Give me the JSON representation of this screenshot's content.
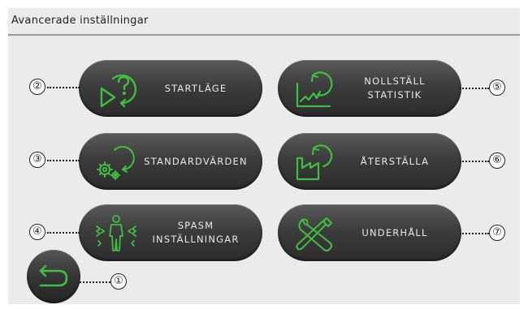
{
  "header": {
    "title": "Avancerade inställningar"
  },
  "buttons": {
    "startlage": {
      "label": "STARTLÄGE",
      "icon": "start-mode-icon"
    },
    "nollstall": {
      "line1": "NOLLSTÄLL",
      "line2": "STATISTIK",
      "icon": "reset-statistics-icon"
    },
    "standardvarden": {
      "label": "STANDARDVÄRDEN",
      "icon": "default-values-icon"
    },
    "aterstalla": {
      "label": "ÅTERSTÄLLA",
      "icon": "factory-reset-icon"
    },
    "spasm": {
      "line1": "SPASM",
      "line2": "INSTÄLLNINGAR",
      "icon": "spasm-body-icon"
    },
    "underhall": {
      "label": "UNDERHÅLL",
      "icon": "tools-icon"
    },
    "back": {
      "icon": "back-arrow-icon"
    }
  },
  "callouts": [
    "①",
    "②",
    "③",
    "④",
    "⑤",
    "⑥",
    "⑦"
  ],
  "colors": {
    "accent": "#3fbf3f",
    "button_dark": "#333333",
    "panel": "#ebebeb"
  }
}
